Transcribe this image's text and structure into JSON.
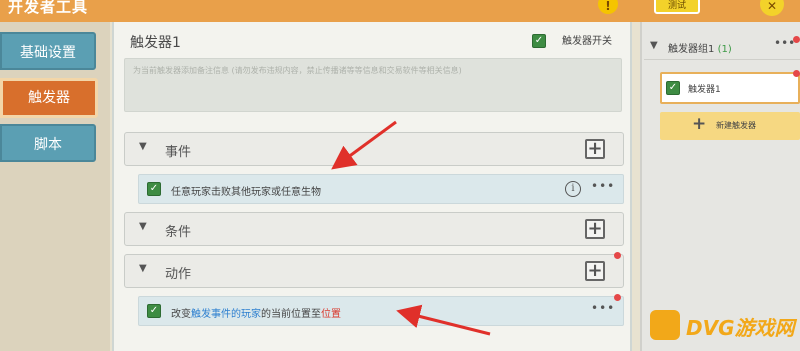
{
  "header": {
    "title": "开发者工具",
    "help_icon": "help-icon",
    "test_label": "测试",
    "close_icon": "close-icon",
    "accent": "#e9a04a"
  },
  "sidebar": {
    "items": [
      {
        "label": "基础设置",
        "active": false
      },
      {
        "label": "触发器",
        "active": true
      },
      {
        "label": "脚本",
        "active": false
      }
    ],
    "active_color": "#d86f2c",
    "normal_color": "#5b9fb3"
  },
  "main": {
    "trigger_title": "触发器1",
    "switch_label": "触发器开关",
    "switch_checked": true,
    "description_placeholder": "为当前触发器添加备注信息 (请勿发布违规内容，禁止传播诸等等信息和交易软件等相关信息)",
    "sections": [
      {
        "title": "事件"
      },
      {
        "title": "条件"
      },
      {
        "title": "动作"
      }
    ],
    "event_row": {
      "text": "任意玩家击败其他玩家或任意生物",
      "info_icon": "info-icon",
      "more_label": "•••"
    },
    "action_row": {
      "prefix": "改变",
      "link1": "触发事件的玩家",
      "middle": "的当前位置至",
      "link2": "位置",
      "more_label": "•••"
    }
  },
  "right_panel": {
    "group_name": "触发器组1",
    "group_count": "(1)",
    "group_more": "•••",
    "trigger_item": "触发器1",
    "new_trigger_label": "新建触发器"
  },
  "watermark": {
    "text": "DVG游戏网"
  },
  "colors": {
    "checkbox": "#3e8c43",
    "link_blue": "#2d7fcf",
    "link_red": "#d9372b",
    "arrow_red": "#e0302a"
  }
}
